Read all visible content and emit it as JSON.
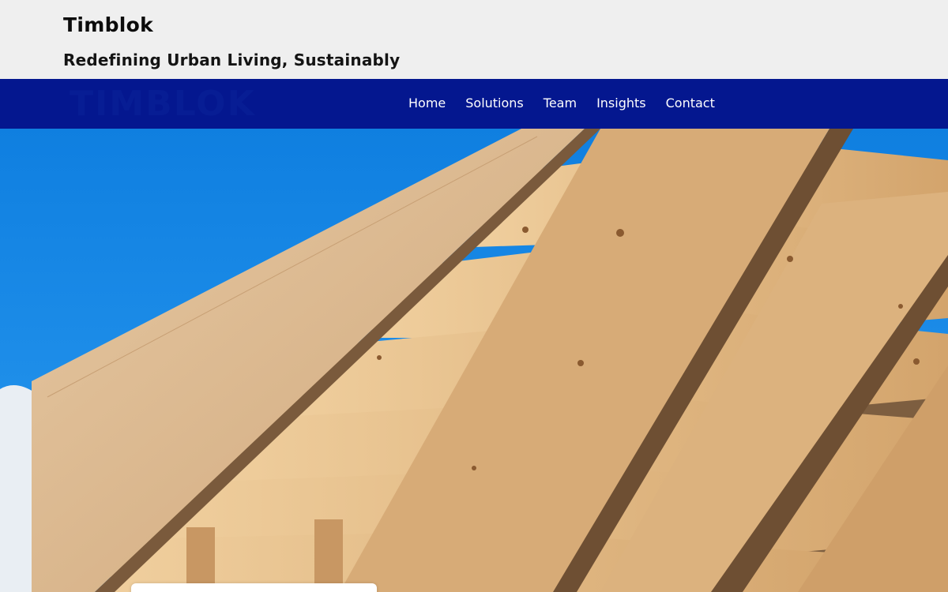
{
  "header": {
    "title": "Timblok",
    "tagline": "Redefining Urban Living, Sustainably"
  },
  "nav": {
    "ghost_logo": "TIMBLOK",
    "items": [
      {
        "label": "Home"
      },
      {
        "label": "Solutions"
      },
      {
        "label": "Team"
      },
      {
        "label": "Insights"
      },
      {
        "label": "Contact"
      }
    ]
  },
  "hero": {
    "image_subject": "timber-beam-structure-against-blue-sky",
    "colors": {
      "sky": "#1a8ce6",
      "wood_light": "#e8c49a",
      "wood_mid": "#d2a36f",
      "wood_shadow": "#8a6a48"
    }
  },
  "colors": {
    "header_bg": "#efefef",
    "nav_bg": "#04178f",
    "nav_text": "#ffffff"
  }
}
